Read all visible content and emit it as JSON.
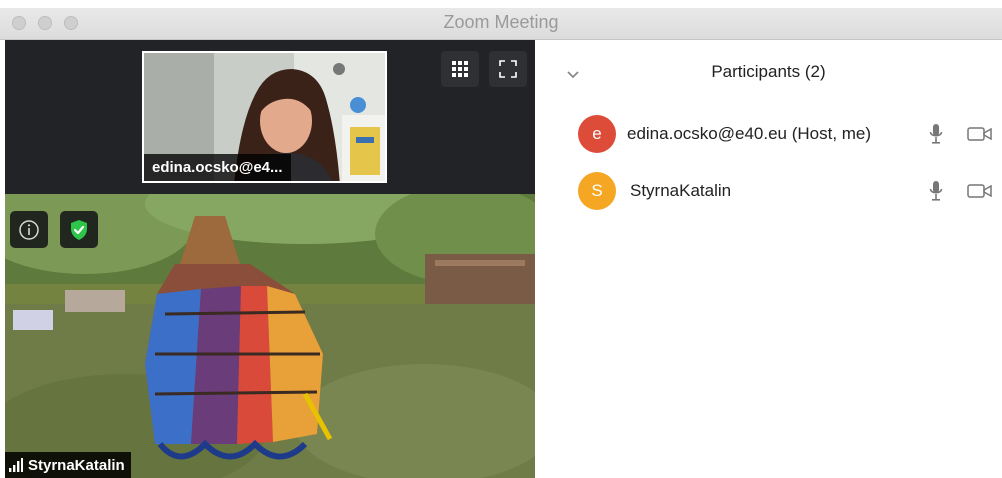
{
  "window": {
    "title": "Zoom Meeting"
  },
  "thumbnail": {
    "name": "edina.ocsko@e4..."
  },
  "main_video": {
    "name": "StyrnaKatalin"
  },
  "toolbar": {
    "grid_icon": "grid-view-icon",
    "fullscreen_icon": "fullscreen-icon"
  },
  "overlay": {
    "info_icon": "info-icon",
    "security_icon": "shield-check-icon",
    "security_color": "#2dc54a"
  },
  "participants": {
    "title": "Participants (2)",
    "items": [
      {
        "initial": "e",
        "name": "edina.ocsko@e40.eu (Host, me)",
        "color": "#dd4b39"
      },
      {
        "initial": "S",
        "name": "StyrnaKatalin",
        "color": "#f5a623"
      }
    ]
  }
}
